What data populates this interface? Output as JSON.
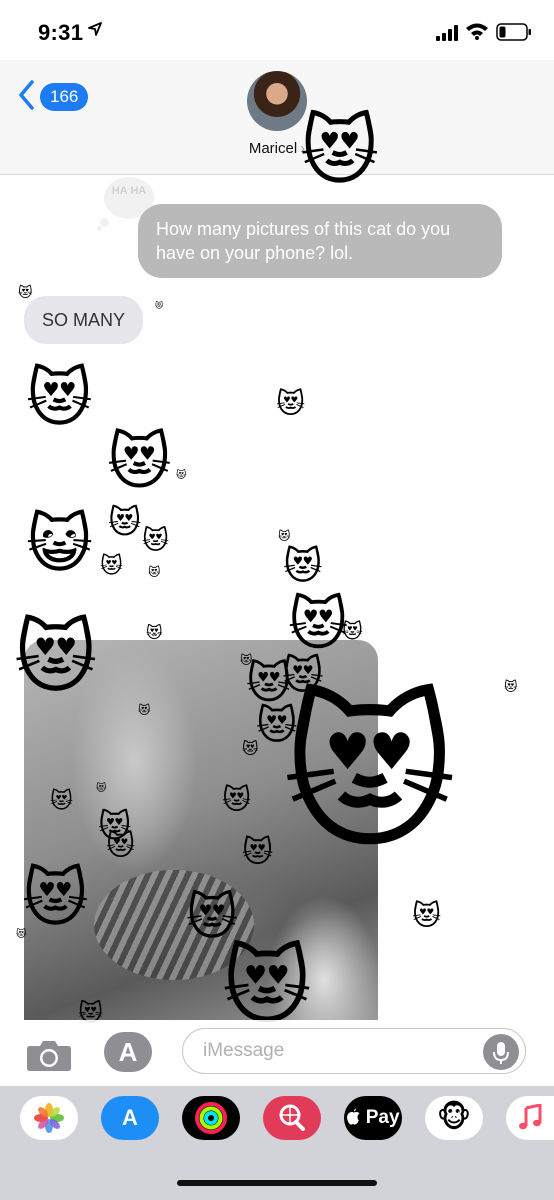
{
  "status_bar": {
    "time": "9:31"
  },
  "header": {
    "back_count": "166",
    "contact_name": "Maricel",
    "contact_chevron": "›"
  },
  "messages": {
    "outgoing_text": "How many pictures of this cat do you have on your phone? lol.",
    "tapback": "HA HA",
    "incoming_text": "SO MANY"
  },
  "emoji": {
    "heart_eyes_cat": "😻",
    "grinning_cat": "😺"
  },
  "input_bar": {
    "placeholder": "iMessage",
    "apps_glyph": "A"
  },
  "app_drawer": {
    "apple_pay_label": "Pay",
    "apps": [
      "photos-app-icon",
      "app-store-app-icon",
      "activity-app-icon",
      "search-images-app-icon",
      "apple-pay-app-icon",
      "animoji-app-icon",
      "music-app-icon"
    ]
  },
  "colors": {
    "accent": "#1d7cf2",
    "outgoing_bubble": "#b9b9b9",
    "incoming_bubble": "#e5e5ea"
  }
}
